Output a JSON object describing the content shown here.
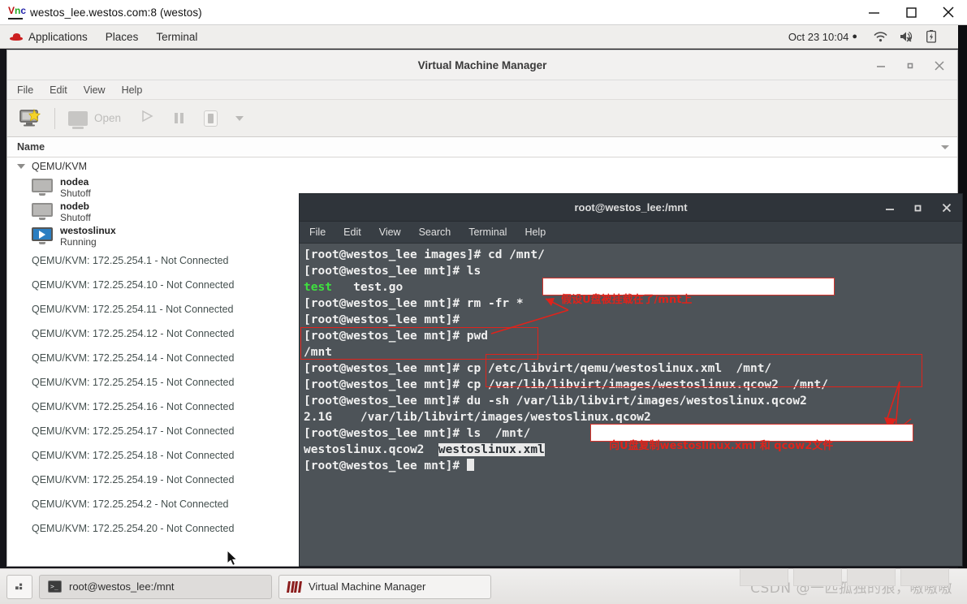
{
  "vnc": {
    "title": "westos_lee.westos.com:8 (westos)",
    "logo": "VNC",
    "minimize": "minimize-icon",
    "maximize": "maximize-icon",
    "close": "close-icon"
  },
  "gnome_panel": {
    "activities": "Applications",
    "places": "Places",
    "terminal": "Terminal",
    "clock": "Oct 23  10:04",
    "dot": "●",
    "icons": [
      "wifi-icon",
      "volume-muted-icon",
      "battery-icon"
    ]
  },
  "vmm": {
    "title": "Virtual Machine Manager",
    "menu": [
      "File",
      "Edit",
      "View",
      "Help"
    ],
    "toolbar": {
      "new_vm": "new-vm-icon",
      "open_label": "Open",
      "run": "run-icon",
      "pause": "pause-icon",
      "stop": "shutdown-icon",
      "dropdown": "chevron-down-icon"
    },
    "column_header": "Name",
    "group": "QEMU/KVM",
    "vms": [
      {
        "name": "nodea",
        "state": "Shutoff",
        "running": false
      },
      {
        "name": "nodeb",
        "state": "Shutoff",
        "running": false
      },
      {
        "name": "westoslinux",
        "state": "Running",
        "running": true
      }
    ],
    "connections": [
      "QEMU/KVM: 172.25.254.1 - Not Connected",
      "QEMU/KVM: 172.25.254.10 - Not Connected",
      "QEMU/KVM: 172.25.254.11 - Not Connected",
      "QEMU/KVM: 172.25.254.12 - Not Connected",
      "QEMU/KVM: 172.25.254.14 - Not Connected",
      "QEMU/KVM: 172.25.254.15 - Not Connected",
      "QEMU/KVM: 172.25.254.16 - Not Connected",
      "QEMU/KVM: 172.25.254.17 - Not Connected",
      "QEMU/KVM: 172.25.254.18 - Not Connected",
      "QEMU/KVM: 172.25.254.19 - Not Connected",
      "QEMU/KVM: 172.25.254.2 - Not Connected",
      "QEMU/KVM: 172.25.254.20 - Not Connected"
    ]
  },
  "terminal": {
    "title": "root@westos_lee:/mnt",
    "menu": [
      "File",
      "Edit",
      "View",
      "Search",
      "Terminal",
      "Help"
    ],
    "lines": [
      "[root@westos_lee images]# cd /mnt/",
      "[root@westos_lee mnt]# ls",
      "test   test.go",
      "[root@westos_lee mnt]# rm -fr *",
      "[root@westos_lee mnt]#",
      "[root@westos_lee mnt]# pwd",
      "/mnt",
      "[root@westos_lee mnt]# cp /etc/libvirt/qemu/westoslinux.xml  /mnt/",
      "[root@westos_lee mnt]# cp /var/lib/libvirt/images/westoslinux.qcow2  /mnt/",
      "[root@westos_lee mnt]# du -sh /var/lib/libvirt/images/westoslinux.qcow2",
      "2.1G    /var/lib/libvirt/images/westoslinux.qcow2",
      "[root@westos_lee mnt]# ls  /mnt/",
      "westoslinux.qcow2  westoslinux.xml",
      "[root@westos_lee mnt]# "
    ],
    "ls_output_green": "test",
    "ls_output_rest": "   test.go",
    "ls_mnt_plain": "westoslinux.qcow2  ",
    "ls_mnt_highlight": "westoslinux.xml"
  },
  "annotations": [
    {
      "text": "假设U盘被挂载在了/mnt上"
    },
    {
      "text": "向U盘复制westoslinux.xml 和 qcow2文件"
    }
  ],
  "taskbar": {
    "show_desktop": "show-desktop-icon",
    "windows": [
      {
        "label": "root@westos_lee:/mnt",
        "icon": "terminal-icon",
        "active": true
      },
      {
        "label": "Virtual Machine Manager",
        "icon": "vmm-icon",
        "active": false
      }
    ],
    "watermark": "CSDN @一匹孤独的狼，嗷嗷嗷"
  }
}
